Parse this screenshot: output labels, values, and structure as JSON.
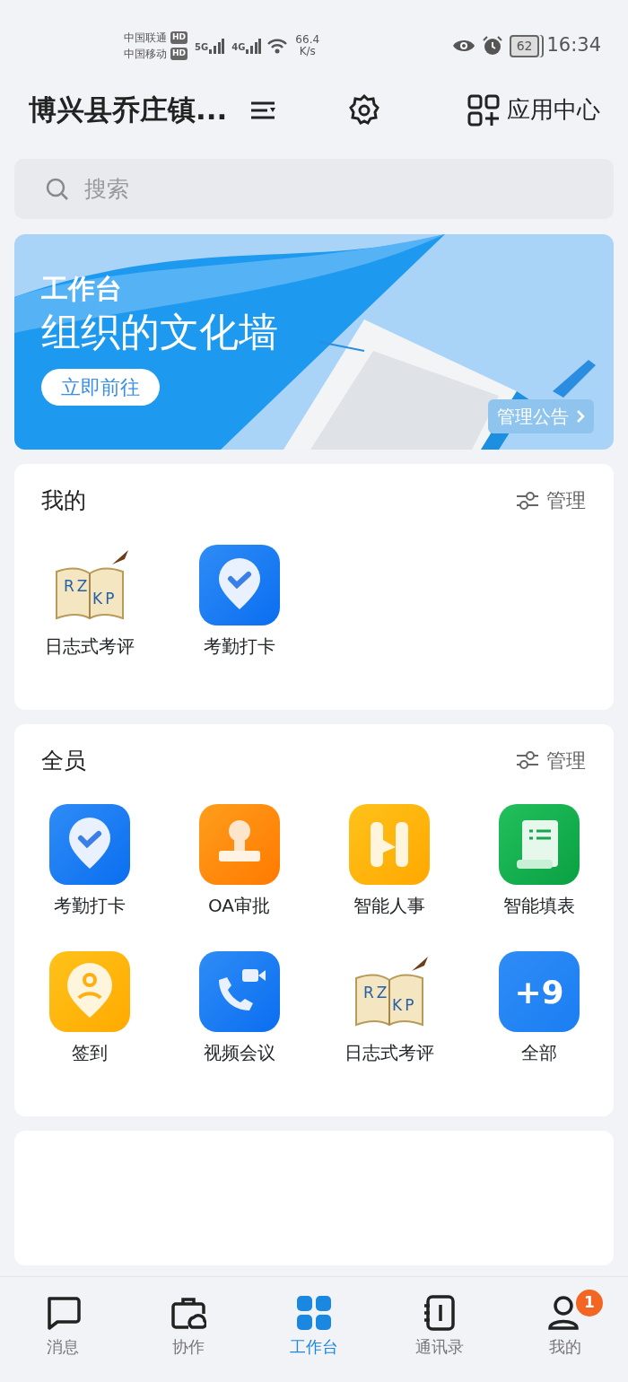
{
  "status_bar": {
    "carriers": [
      {
        "name": "中国联通",
        "badge": "HD"
      },
      {
        "name": "中国移动",
        "badge": "HD"
      }
    ],
    "networks": [
      "5G",
      "4G"
    ],
    "speed": "66.4",
    "speed_unit": "K/s",
    "battery": "62",
    "time": "16:34"
  },
  "header": {
    "title": "博兴县乔庄镇...",
    "app_center": "应用中心"
  },
  "search": {
    "placeholder": "搜索"
  },
  "banner": {
    "kicker": "工作台",
    "headline": "组织的文化墙",
    "button": "立即前往",
    "manage": "管理公告"
  },
  "sections": [
    {
      "title": "我的",
      "manage": "管理",
      "apps": [
        {
          "kind": "book",
          "label": "日志式考评",
          "marks": [
            "RZ",
            "KP"
          ]
        },
        {
          "kind": "checkin",
          "label": "考勤打卡"
        }
      ]
    },
    {
      "title": "全员",
      "manage": "管理",
      "apps": [
        {
          "kind": "checkin",
          "label": "考勤打卡"
        },
        {
          "kind": "stamp",
          "label": "OA审批"
        },
        {
          "kind": "h",
          "label": "智能人事"
        },
        {
          "kind": "form",
          "label": "智能填表"
        },
        {
          "kind": "sign",
          "label": "签到"
        },
        {
          "kind": "video",
          "label": "视频会议"
        },
        {
          "kind": "book",
          "label": "日志式考评",
          "marks": [
            "RZ",
            "KP"
          ]
        },
        {
          "kind": "more",
          "label": "全部",
          "text": "+9"
        }
      ]
    }
  ],
  "tabs": [
    {
      "kind": "chat",
      "label": "消息",
      "selected": false
    },
    {
      "kind": "case",
      "label": "协作",
      "selected": false
    },
    {
      "kind": "grid",
      "label": "工作台",
      "selected": true
    },
    {
      "kind": "contacts",
      "label": "通讯录",
      "selected": false
    },
    {
      "kind": "person",
      "label": "我的",
      "selected": false,
      "badge": "1"
    }
  ]
}
